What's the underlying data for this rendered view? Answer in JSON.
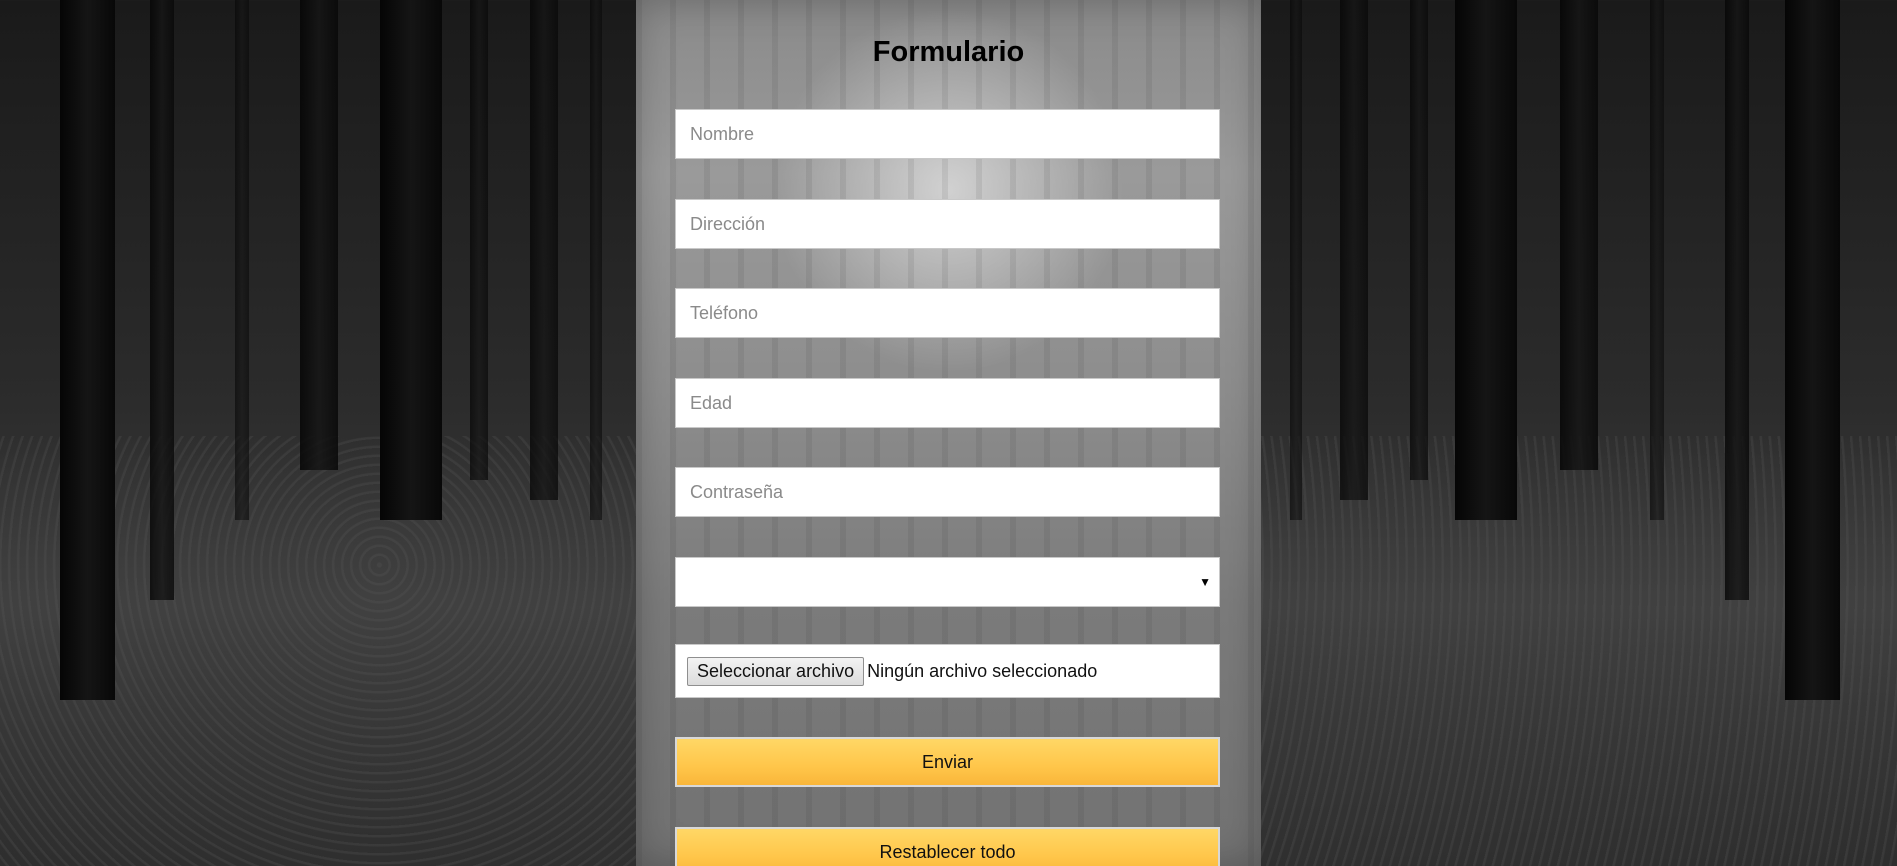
{
  "form": {
    "title": "Formulario",
    "fields": {
      "nombre_placeholder": "Nombre",
      "direccion_placeholder": "Dirección",
      "telefono_placeholder": "Teléfono",
      "edad_placeholder": "Edad",
      "contrasena_placeholder": "Contraseña"
    },
    "select": {
      "selected": "",
      "arrow_icon": "triangle-down-icon"
    },
    "file": {
      "button_label": "Seleccionar archivo",
      "status": "Ningún archivo seleccionado"
    },
    "submit_label": "Enviar",
    "reset_label": "Restablecer todo"
  },
  "colors": {
    "button_yellow": "#ffc64a",
    "field_background": "#ffffff",
    "title_text": "#000000"
  }
}
